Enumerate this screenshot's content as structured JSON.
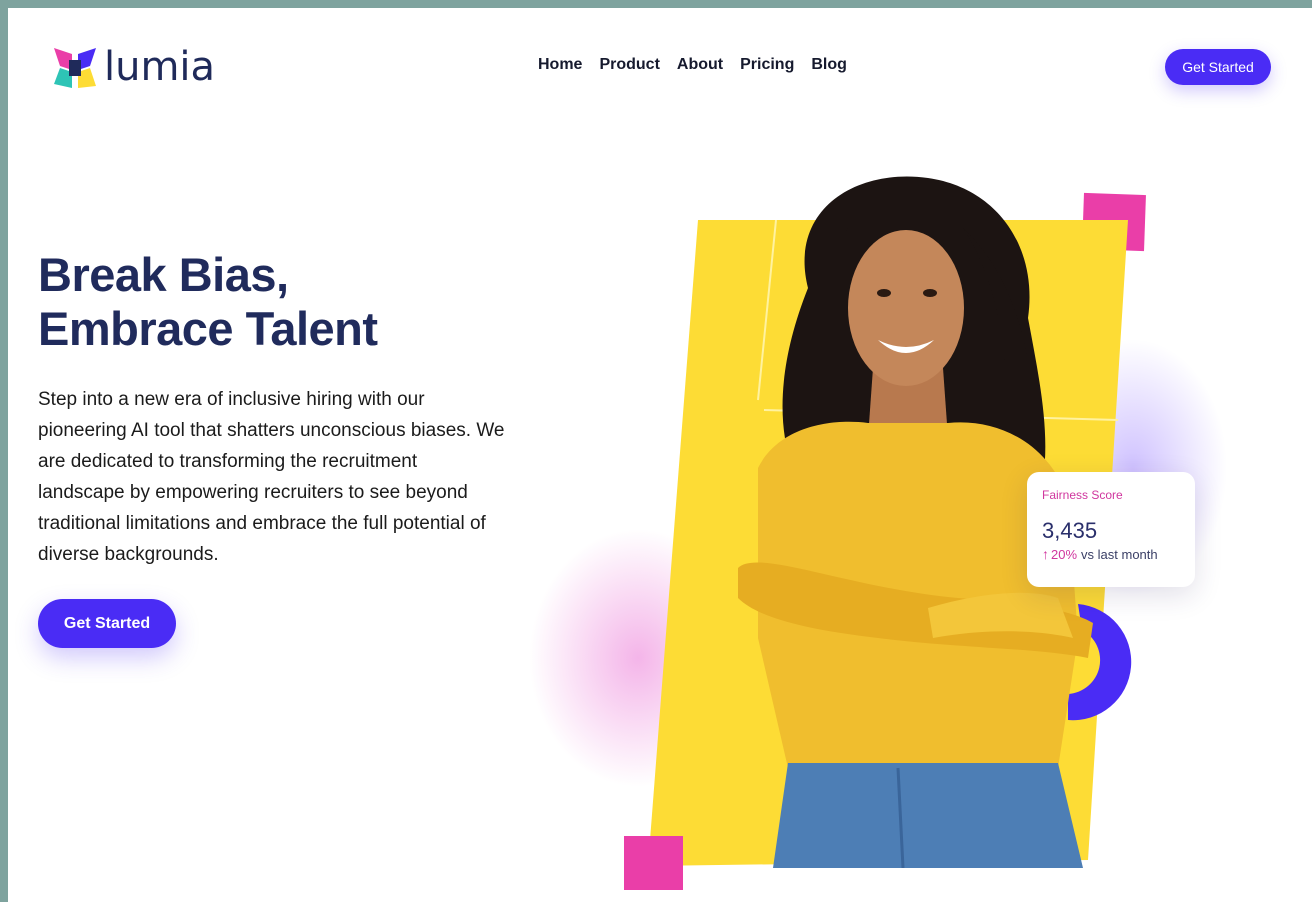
{
  "brand": {
    "name": "lumia"
  },
  "nav": {
    "items": [
      {
        "label": "Home"
      },
      {
        "label": "Product"
      },
      {
        "label": "About"
      },
      {
        "label": "Pricing"
      },
      {
        "label": "Blog"
      }
    ],
    "cta_label": "Get Started"
  },
  "hero": {
    "title_line1": "Break Bias,",
    "title_line2": "Embrace Talent",
    "description": "Step into a new era of inclusive hiring with our pioneering AI tool that shatters unconscious biases. We are dedicated to transforming the recruitment landscape by empowering recruiters to see beyond traditional limitations and embrace the full potential of diverse backgrounds.",
    "cta_label": "Get Started"
  },
  "stat_card": {
    "label": "Fairness Score",
    "value": "3,435",
    "change_pct": "20%",
    "change_text": "vs last month",
    "trend_icon": "arrow-up-icon"
  },
  "colors": {
    "primary": "#4a2cf5",
    "heading": "#202b5c",
    "accent_pink": "#ea3ea8",
    "accent_yellow": "#fddc35",
    "frame_bg": "#7ea39e"
  }
}
